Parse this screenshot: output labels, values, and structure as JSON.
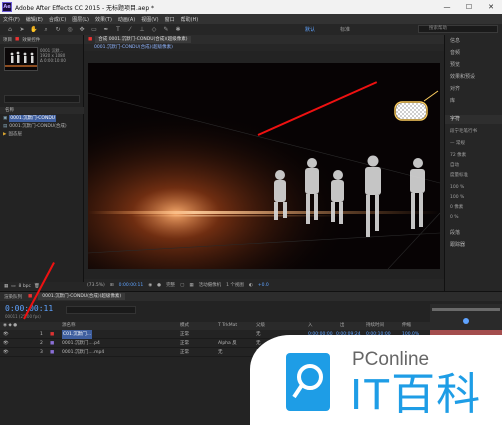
{
  "titlebar": {
    "title": "Adobe After Effects CC 2015 - 无标题项目.aep *",
    "logo_text": "Ae",
    "minimize": "—",
    "maximize": "☐",
    "close": "✕"
  },
  "menu": [
    "文件(F)",
    "编辑(E)",
    "合成(C)",
    "图层(L)",
    "效果(T)",
    "动画(A)",
    "视图(V)",
    "窗口",
    "帮助(H)"
  ],
  "toolbar": {
    "workspace_active": "默认",
    "workspace_other": "标准",
    "search_placeholder": "搜索帮助"
  },
  "project": {
    "tab_label": "项目",
    "tab_effects": "效果控件",
    "thumb_info": [
      "0001 沉默...",
      "1920 x 1080",
      "Δ 0:00:10:00"
    ],
    "col_name": "名称",
    "items": [
      {
        "name": "0001.沉默门-CONDU",
        "selected": true
      },
      {
        "name": "0001.沉默门-CONDU(合成)",
        "selected": false
      },
      {
        "name": "固态层",
        "selected": false
      }
    ],
    "bpc": "8 bpc"
  },
  "composition": {
    "tab_label": "合成 0001.沉默门-CONDU(合成)(超级像素)",
    "breadcrumb": "0001.沉默门-CONDU(合成)(超级像素)",
    "controls": {
      "zoom": "(73.5%)",
      "timecode": "0:00:00:11",
      "resolution": "完整",
      "camera": "活动摄像机",
      "views": "1 个视图",
      "offset": "+0.0"
    }
  },
  "right_panels": {
    "items": [
      "信息",
      "音频",
      "预览",
      "效果和预设",
      "对齐",
      "库",
      "字符",
      "段落"
    ],
    "character": {
      "font": "段宁毛笔行书",
      "fill": "— 常规",
      "size_t": "72 像素",
      "leading": "自动",
      "tracking": "度量标准",
      "scale_v": "100 %",
      "scale_h": "100 %",
      "baseline": "0 像素",
      "tsume": "0 %"
    },
    "lower_items": [
      "段落",
      "跟踪器"
    ]
  },
  "timeline": {
    "tabs": [
      "渲染队列",
      "0001.沉默门-CONDU(合成)(超级像素)"
    ],
    "time": "0:00:00:11",
    "fps": "00011 (25.00 fps)",
    "headers": {
      "name": "源名称",
      "mode": "模式",
      "trkmat": "T TrkMat",
      "parent": "父级",
      "in": "入",
      "out": "出",
      "duration": "持续时间",
      "stretch": "伸缩"
    },
    "rows": [
      {
        "num": "1",
        "name": "C01.沉默门...",
        "mode": "正常",
        "trkmat": "",
        "parent": "无",
        "in": "0:00:00:00",
        "out": "0:00:09:24",
        "duration": "0:00:10:00",
        "stretch": "100.0%",
        "selected": true
      },
      {
        "num": "2",
        "name": "0001.沉默门....p4",
        "mode": "正常",
        "trkmat": "Alpha 反",
        "parent": "无",
        "in": "0:00:00:00",
        "out": "0:00:09:24",
        "duration": "0:00:10:00",
        "stretch": "100.0%",
        "selected": false
      },
      {
        "num": "3",
        "name": "0001.沉默门....mp4",
        "mode": "正常",
        "trkmat": "无",
        "parent": "无",
        "in": "0:00:00:00",
        "out": "0:00:09:24",
        "duration": "0:00:10:00",
        "stretch": "100.0%",
        "selected": false
      }
    ]
  },
  "watermark": {
    "top": "PConline",
    "bottom": "IT百科"
  },
  "colors": {
    "accent_blue": "#5fa3ff",
    "selection": "#3f5f9f",
    "arrow_red": "#e11111",
    "brand_blue": "#1e9de6"
  }
}
